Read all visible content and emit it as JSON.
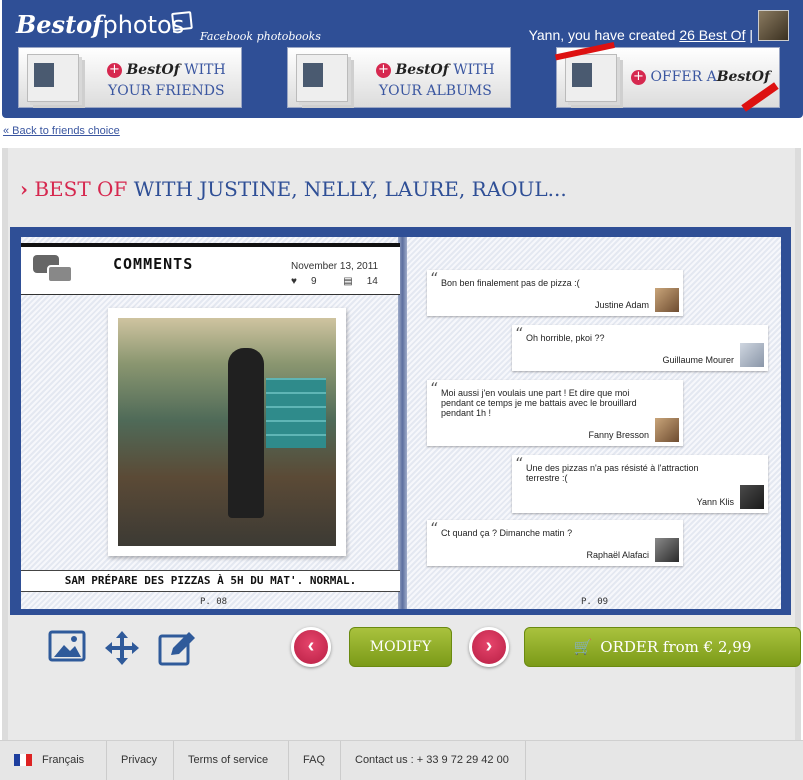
{
  "header": {
    "logo_bold": "Bestof",
    "logo_light": "photos",
    "tagline": "Facebook photobooks",
    "user_prefix": "Yann, you have created",
    "user_link": "26 Best Of",
    "user_sep": "|",
    "buttons": [
      {
        "brand": "BestOf",
        "line1_suffix": "WITH",
        "line2": "YOUR FRIENDS"
      },
      {
        "brand": "BestOf",
        "line1_suffix": "WITH",
        "line2": "YOUR ALBUMS"
      },
      {
        "prefix": "OFFER A",
        "brand": "BestOf"
      }
    ]
  },
  "back_link": "« Back to friends choice",
  "title": {
    "prefix": "BEST OF",
    "rest": "WITH JUSTINE, NELLY, LAURE, RAOUL..."
  },
  "left_page": {
    "heading": "COMMENTS",
    "date": "November 13, 2011",
    "likes": "9",
    "comments": "14",
    "caption": "SAM PRÉPARE DES PIZZAS À 5H DU MAT'. NORMAL.",
    "page_number": "P. 08"
  },
  "right_page": {
    "page_number": "P. 09",
    "comments": [
      {
        "text": "Bon ben finalement pas de pizza :(",
        "author": "Justine Adam"
      },
      {
        "text": "Oh horrible, pkoi ??",
        "author": "Guillaume Mourer"
      },
      {
        "text": "Moi aussi j'en voulais une part ! Et dire que moi pendant ce temps je me battais avec le brouillard pendant 1h !",
        "author": "Fanny Bresson"
      },
      {
        "text": "Une des pizzas n'a pas résisté à l'attraction terrestre :(",
        "author": "Yann Klis"
      },
      {
        "text": "Ct quand ça ? Dimanche matin ?",
        "author": "Raphaël Alafaci"
      }
    ]
  },
  "actions": {
    "prev": "‹",
    "next": "›",
    "modify": "MODIFY",
    "order": "ORDER from € 2,99"
  },
  "footer": {
    "language": "Français",
    "privacy": "Privacy",
    "terms": "Terms of service",
    "faq": "FAQ",
    "contact": "Contact us : + 33 9 72 29 42 00"
  },
  "colors": {
    "brand_blue": "#2f4f96",
    "accent_pink": "#d6284f",
    "order_green": "#8eab28"
  }
}
